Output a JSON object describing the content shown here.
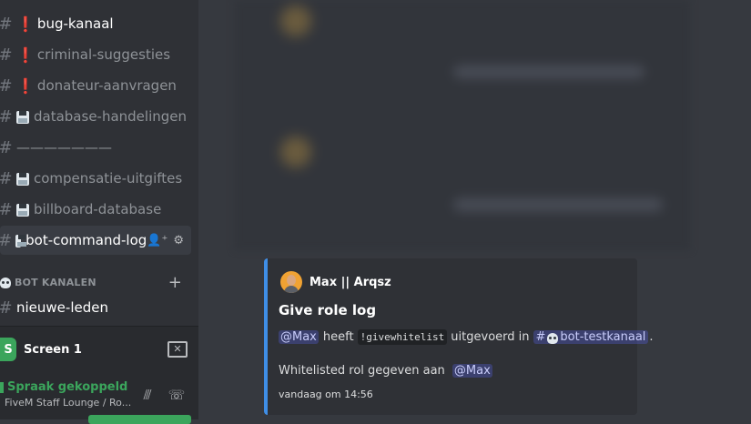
{
  "sidebar": {
    "channels": [
      {
        "name": "bug-kanaal",
        "prefix": "warning",
        "state": "unread"
      },
      {
        "name": "criminal-suggesties",
        "prefix": "warning",
        "state": "normal"
      },
      {
        "name": "donateur-aanvragen",
        "prefix": "warning",
        "state": "normal"
      },
      {
        "name": "database-handelingen",
        "prefix": "floppy",
        "state": "normal"
      },
      {
        "name": "———————",
        "prefix": "",
        "state": "normal"
      },
      {
        "name": "compensatie-uitgiftes",
        "prefix": "floppy",
        "state": "normal"
      },
      {
        "name": "billboard-database",
        "prefix": "floppy",
        "state": "normal"
      },
      {
        "name": "bot-command-log",
        "prefix": "floppy",
        "state": "selected"
      }
    ],
    "category": {
      "label": "BOT KANALEN"
    },
    "after_category": [
      {
        "name": "nieuwe-leden",
        "state": "unread"
      }
    ],
    "warn_glyph": "❗",
    "hash_glyph": "#",
    "invite_icon": "👤⁺",
    "settings_icon": "⚙",
    "plus_glyph": "+"
  },
  "panel": {
    "screen_label": "Screen 1",
    "screen_icon_letter": "S",
    "screen_button_glyph": "✕",
    "voice_status": "Spraak gekoppeld",
    "voice_channel": "FiveM Staff Lounge / Ro...",
    "noise_icon": "⫻",
    "disconnect_icon": "☏"
  },
  "embed": {
    "author": "Max || Arqsz",
    "title": "Give role log",
    "desc": {
      "mention": "@Max",
      "text1": "heeft",
      "command": "!givewhitelist",
      "text2": "uitgevoerd in",
      "channel_hash": "#",
      "channel": "bot-testkanaal",
      "end": "."
    },
    "field": {
      "text": "Whitelisted rol gegeven aan",
      "mention": "@Max"
    },
    "footer": "vandaag om 14:56"
  },
  "colors": {
    "accent_bar": "#3f8ee6",
    "voice_green": "#3ba55c",
    "mention": "#c9cdfb"
  }
}
